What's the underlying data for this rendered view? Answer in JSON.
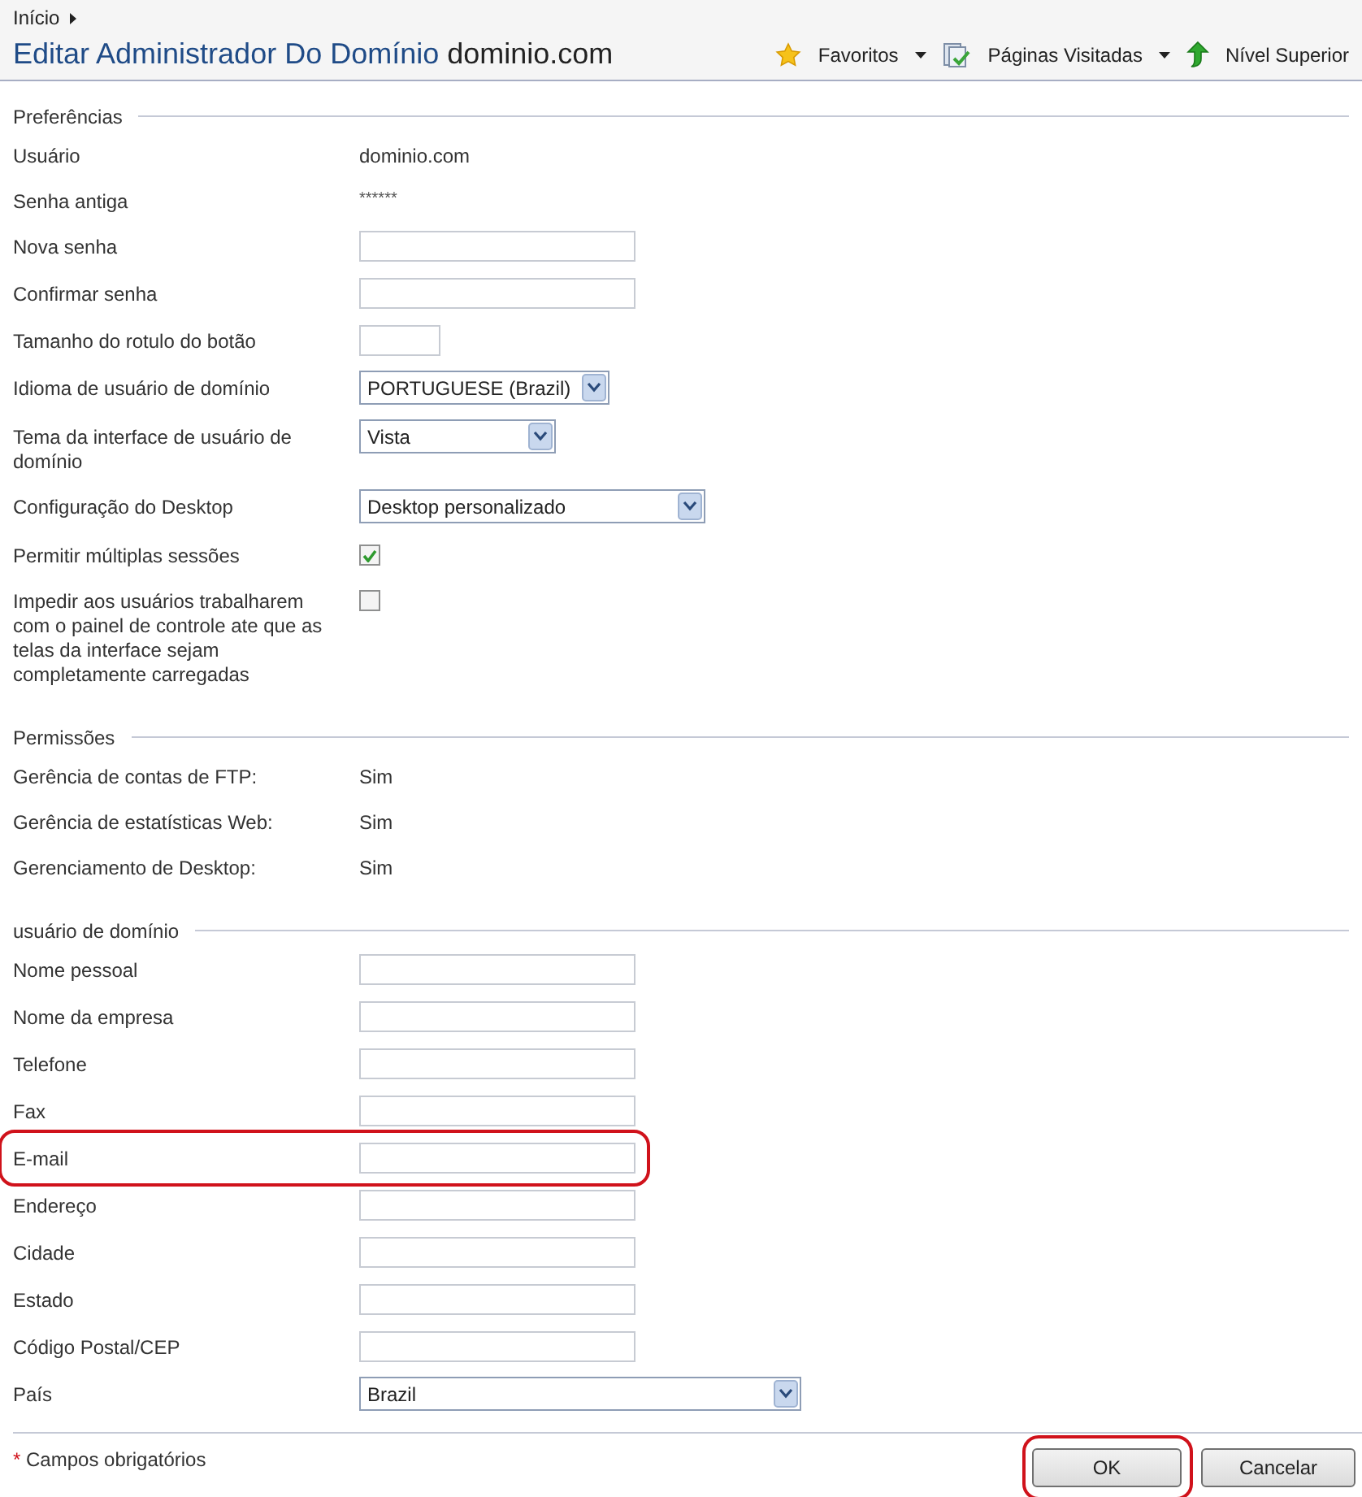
{
  "breadcrumb": {
    "items": [
      "Início"
    ]
  },
  "header": {
    "title": "Editar Administrador Do Domínio",
    "subtitle": "dominio.com",
    "actions": [
      {
        "label": "Favoritos",
        "kind": "star",
        "dropdown": true
      },
      {
        "label": "Páginas Visitadas",
        "kind": "pages",
        "dropdown": true
      },
      {
        "label": "Nível Superior",
        "kind": "up",
        "dropdown": false
      }
    ]
  },
  "sections": [
    {
      "title": "Preferências",
      "rows": [
        {
          "label": "Usuário",
          "kind": "text",
          "value": "dominio.com"
        },
        {
          "label": "Senha antiga",
          "kind": "mask",
          "value": "******"
        },
        {
          "label": "Nova senha",
          "kind": "input"
        },
        {
          "label": "Confirmar senha",
          "kind": "input"
        },
        {
          "label": "Tamanho do rotulo do botão",
          "kind": "short-input"
        },
        {
          "label": "Idioma de usuário de domínio",
          "kind": "select",
          "value": "PORTUGUESE (Brazil)"
        },
        {
          "label": "Tema da interface de usuário de domínio",
          "kind": "select",
          "value": "Vista"
        },
        {
          "label": "Configuração do Desktop",
          "kind": "select",
          "value": "Desktop personalizado"
        },
        {
          "label": "Permitir múltiplas sessões",
          "kind": "checkbox",
          "checked": true
        },
        {
          "label": "Impedir aos usuários trabalharem com o painel de controle ate que as telas da interface sejam completamente carregadas",
          "kind": "checkbox",
          "checked": false
        }
      ]
    },
    {
      "title": "Permissões",
      "rows": [
        {
          "label": "Gerência de contas de FTP:",
          "kind": "text",
          "value": "Sim"
        },
        {
          "label": "Gerência de estatísticas Web:",
          "kind": "text",
          "value": "Sim"
        },
        {
          "label": "Gerenciamento de Desktop:",
          "kind": "text",
          "value": "Sim"
        }
      ]
    },
    {
      "title": "usuário de domínio",
      "rows": [
        {
          "label": "Nome pessoal",
          "kind": "input"
        },
        {
          "label": "Nome da empresa",
          "kind": "input"
        },
        {
          "label": "Telefone",
          "kind": "input"
        },
        {
          "label": "Fax",
          "kind": "input"
        },
        {
          "label": "E-mail",
          "kind": "input",
          "highlighted": true
        },
        {
          "label": "Endereço",
          "kind": "input"
        },
        {
          "label": "Cidade",
          "kind": "input"
        },
        {
          "label": "Estado",
          "kind": "input"
        },
        {
          "label": "Código Postal/CEP",
          "kind": "input"
        },
        {
          "label": "País",
          "kind": "select",
          "value": "Brazil"
        }
      ]
    }
  ],
  "footer": {
    "required_mark": "*",
    "required_note": "Campos obrigatórios",
    "buttons": [
      {
        "label": "OK",
        "highlighted": true
      },
      {
        "label": "Cancelar",
        "highlighted": false
      }
    ]
  }
}
